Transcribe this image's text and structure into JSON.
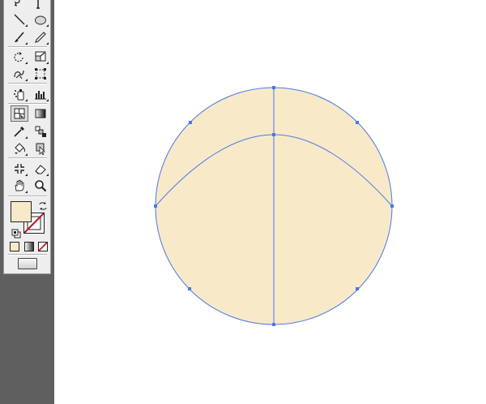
{
  "colors": {
    "fill": "#f8e9c9",
    "selection": "#4a79e6",
    "toolbox_bg": "#eeeeee",
    "gutter": "#5f5f5f",
    "none_slash": "#c0192b"
  },
  "toolbox": {
    "tools": [
      {
        "name": "lasso-tool-icon"
      },
      {
        "name": "type-tool-icon"
      },
      {
        "name": "line-segment-tool-icon"
      },
      {
        "name": "ellipse-tool-icon"
      },
      {
        "name": "paintbrush-tool-icon"
      },
      {
        "name": "pencil-tool-icon"
      },
      {
        "name": "rotate-tool-icon"
      },
      {
        "name": "scale-tool-icon"
      },
      {
        "name": "warp-tool-icon"
      },
      {
        "name": "free-transform-tool-icon"
      },
      {
        "name": "symbol-sprayer-tool-icon"
      },
      {
        "name": "column-graph-tool-icon"
      },
      {
        "name": "mesh-tool-icon"
      },
      {
        "name": "gradient-tool-icon"
      },
      {
        "name": "eyedropper-tool-icon"
      },
      {
        "name": "blend-tool-icon"
      },
      {
        "name": "live-paint-bucket-tool-icon"
      },
      {
        "name": "live-paint-selection-tool-icon"
      },
      {
        "name": "slice-tool-icon"
      },
      {
        "name": "eraser-tool-icon"
      },
      {
        "name": "hand-tool-icon"
      },
      {
        "name": "zoom-tool-icon"
      }
    ],
    "fill_swatch": "#f8e9c9",
    "stroke_swatch": "none"
  }
}
